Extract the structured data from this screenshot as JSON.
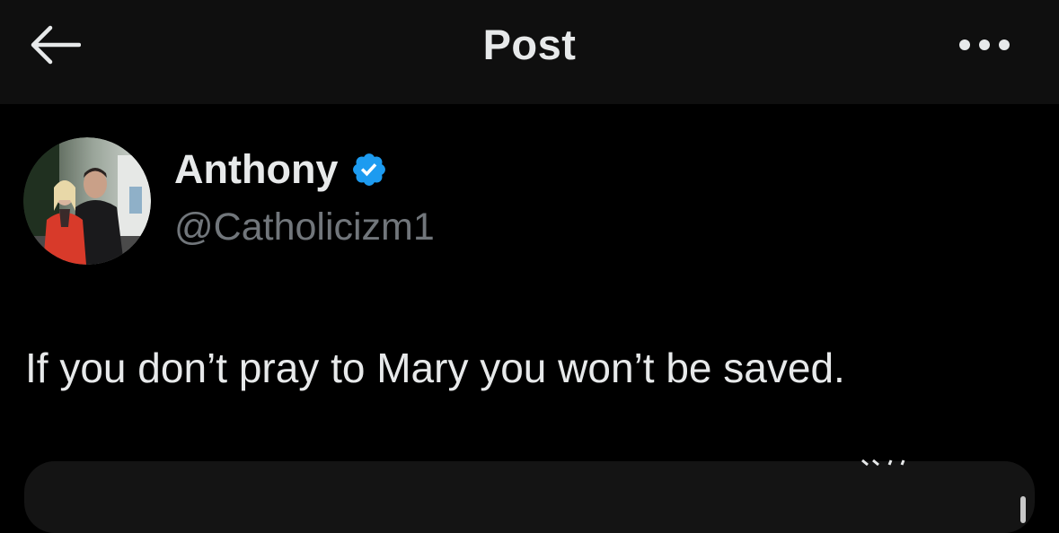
{
  "header": {
    "title": "Post",
    "back_icon": "arrow-left-icon",
    "more_icon": "more-horizontal-icon"
  },
  "author": {
    "display_name": "Anthony",
    "handle": "@Catholicizm1",
    "verified_icon": "verified-badge-icon",
    "verified_color": "#1d9bf0"
  },
  "post": {
    "text": "If you don’t pray to Mary you won’t be saved."
  },
  "colors": {
    "background": "#000000",
    "header_background": "#0f0f0f",
    "primary_text": "#e7e9ea",
    "secondary_text": "#71767b",
    "accent": "#1d9bf0"
  }
}
